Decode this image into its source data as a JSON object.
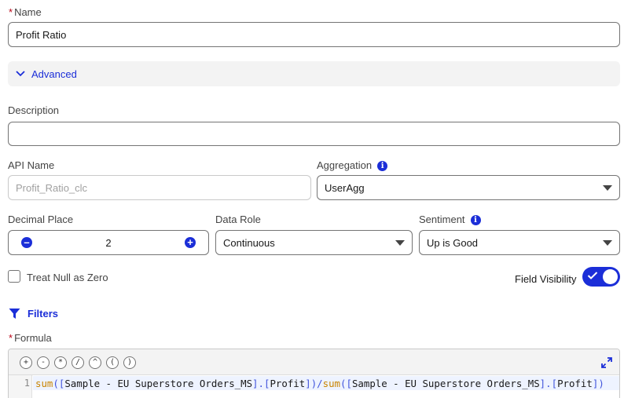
{
  "name": {
    "label": "Name",
    "required_mark": "*",
    "value": "Profit Ratio"
  },
  "advanced": {
    "label": "Advanced"
  },
  "description": {
    "label": "Description",
    "value": ""
  },
  "api_name": {
    "label": "API Name",
    "placeholder": "Profit_Ratio_clc"
  },
  "aggregation": {
    "label": "Aggregation",
    "value": "UserAgg"
  },
  "decimal_place": {
    "label": "Decimal Place",
    "value": "2"
  },
  "data_role": {
    "label": "Data Role",
    "value": "Continuous"
  },
  "sentiment": {
    "label": "Sentiment",
    "value": "Up is Good"
  },
  "treat_null": {
    "label": "Treat Null as Zero",
    "checked": false
  },
  "field_visibility": {
    "label": "Field Visibility",
    "on": true
  },
  "filters": {
    "label": "Filters"
  },
  "formula": {
    "label": "Formula",
    "required_mark": "*",
    "operators": [
      "+",
      "-",
      "*",
      "/",
      "^",
      "(",
      ")"
    ],
    "line_number": "1",
    "tokens": {
      "fn1": "sum",
      "open1": "(",
      "lb1": "[",
      "ds1": "Sample - EU Superstore Orders_MS",
      "rb1": "]",
      "dot1": ".",
      "lb2": "[",
      "f1": "Profit",
      "rb2": "]",
      "close1": ")",
      "div": "/",
      "fn2": "sum",
      "open2": "(",
      "lb3": "[",
      "ds2": "Sample - EU Superstore Orders_MS",
      "rb3": "]",
      "dot2": ".",
      "lb4": "[",
      "f2": "Profit",
      "rb4": "]",
      "close2": ")"
    }
  },
  "colors": {
    "brand": "#1b2ed8",
    "required": "#ba0517",
    "function": "#c98400"
  }
}
